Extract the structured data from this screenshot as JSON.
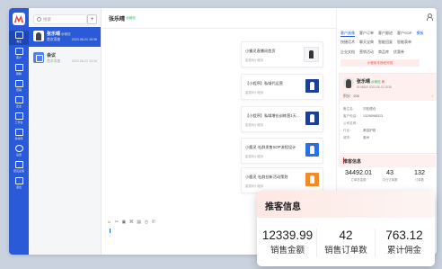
{
  "nav": {
    "items": [
      {
        "label": "消息"
      },
      {
        "label": "客户"
      },
      {
        "label": "群聊"
      },
      {
        "label": "营销"
      },
      {
        "label": "企业"
      },
      {
        "label": "工作台"
      },
      {
        "label": "素材库"
      },
      {
        "label": "设置"
      },
      {
        "label": "意见反馈"
      },
      {
        "label": "退出"
      }
    ]
  },
  "conv_list": {
    "search_placeholder": "搜索",
    "add_label": "+",
    "items": [
      {
        "name": "张乐晴",
        "tag": "@微信",
        "message": "首次添加",
        "time": "2023-08-21 15:36"
      },
      {
        "name": "会议",
        "tag": "",
        "message": "首次添加",
        "time": "2023-08-21 15:36"
      }
    ]
  },
  "chat": {
    "contact_name": "张乐晴",
    "contact_tag": "@微信",
    "cards": [
      {
        "title": "小霸灵直播间首页",
        "subtitle": "星推码小程序"
      },
      {
        "title": "【小程序】私域代运营",
        "subtitle": "星推码小程序"
      },
      {
        "title": "【小程序】私域增长训练营1天…",
        "subtitle": "星推码小程序"
      },
      {
        "title": "小鹿灵·社群发售SOP流程设计",
        "subtitle": "星推码小程序"
      },
      {
        "title": "小鹿灵·社群拉新活动策划",
        "subtitle": "星推码小程序"
      }
    ],
    "toolbar_icons": [
      "☺",
      "✂",
      "▣",
      "⌘",
      "▤",
      "◷",
      "✆"
    ]
  },
  "panel": {
    "tabs_row1": [
      "客户画像",
      "客户订单",
      "客户跟进",
      "客户SOP",
      "模板"
    ],
    "tabs_row2": [
      "快捷话术",
      "聊天宝典",
      "智能回复",
      "智能表单"
    ],
    "tabs_row3": [
      "企业文档",
      "营销活动",
      "商品库",
      "优惠券"
    ],
    "notice": "小程序未授权完成",
    "customer": {
      "name": "张乐晴",
      "source": "@微信",
      "level": "黄",
      "id": "ID:06819  2023-08-21 15:36",
      "points_label": "积分：205",
      "rows": [
        {
          "k": "备注名：",
          "v": "刘亚德仓"
        },
        {
          "k": "客户电话：",
          "v": "13298968323"
        },
        {
          "k": "公司名称：",
          "v": ""
        },
        {
          "k": "行业：",
          "v": "美容护肤"
        },
        {
          "k": "城市：",
          "v": "惠州"
        }
      ]
    },
    "promo_title": "推客信息",
    "stats": [
      {
        "value": "34492.01",
        "label": "订单总金额"
      },
      {
        "value": "43",
        "label": "今日订单数"
      },
      {
        "value": "132",
        "label": "订单数"
      }
    ]
  },
  "overlay": {
    "title": "推客信息",
    "stats": [
      {
        "value": "12339.99",
        "label": "销售金额"
      },
      {
        "value": "42",
        "label": "销售订单数"
      },
      {
        "value": "763.12",
        "label": "累计佣金"
      }
    ]
  }
}
